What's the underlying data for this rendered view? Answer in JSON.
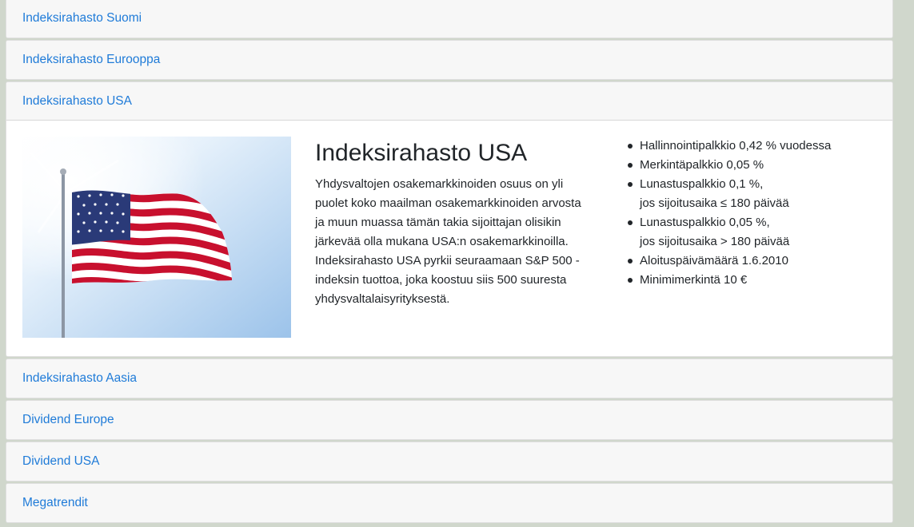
{
  "accordion": {
    "items": [
      {
        "label": "Indeksirahasto Suomi"
      },
      {
        "label": "Indeksirahasto Eurooppa"
      },
      {
        "label": "Indeksirahasto USA"
      },
      {
        "label": "Indeksirahasto Aasia"
      },
      {
        "label": "Dividend Europe"
      },
      {
        "label": "Dividend USA"
      },
      {
        "label": "Megatrendit"
      }
    ],
    "expanded": {
      "title": "Indeksirahasto USA",
      "image_alt": "american-flag-photo",
      "description": "Yhdysvaltojen osakemarkkinoiden osuus on yli puolet koko maailman osakemarkkinoiden arvosta ja muun muassa tämän takia sijoittajan olisikin järkevää olla mukana USA:n osakemarkkinoilla. Indeksirahasto USA pyrkii seuraamaan S&P 500 -indeksin tuottoa, joka koostuu siis 500 suuresta yhdysvaltalaisyrityksestä.",
      "fees": [
        {
          "line1": "Hallinnointipalkkio 0,42 % vuodessa",
          "line2": ""
        },
        {
          "line1": "Merkintäpalkkio 0,05 %",
          "line2": ""
        },
        {
          "line1": "Lunastuspalkkio 0,1 %,",
          "line2": "jos sijoitusaika ≤ 180 päivää"
        },
        {
          "line1": "Lunastuspalkkio 0,05 %,",
          "line2": "jos sijoitusaika > 180 päivää"
        },
        {
          "line1": "Aloituspäivämäärä 1.6.2010",
          "line2": ""
        },
        {
          "line1": "Minimimerkintä 10 €",
          "line2": ""
        }
      ]
    }
  },
  "colors": {
    "link": "#1f7bd8",
    "header_bg": "#f7f7f7",
    "page_bg": "#d0d7cc",
    "text": "#212529"
  }
}
